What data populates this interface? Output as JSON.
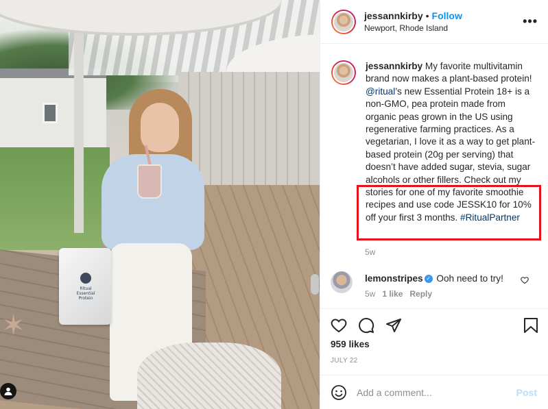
{
  "header": {
    "username": "jessannkirby",
    "dot": "•",
    "follow_label": "Follow",
    "location": "Newport, Rhode Island",
    "more_label": "•••"
  },
  "photo": {
    "bag_label": "Ritual Essential Protein"
  },
  "caption": {
    "username": "jessannkirby",
    "text_part1": " My favorite multivitamin brand now makes a plant-based protein! ",
    "mention": "@ritual",
    "text_part2": "’s new Essential Protein 18+ is a non-GMO, pea protein made from organic peas grown in the US using regenerative farming practices. As a vegetarian, I love it as a way to get plant-based protein (20g per serving) that doesn’t have added sugar, stevia, sugar alcohols or other fillers. Check out my stories for one of my favorite smoothie recipes and use code JESSK10 for 10% off your first 3 months. ",
    "hashtag": "#RitualPartner",
    "time_ago": "5w"
  },
  "comment": {
    "username": "lemonstripes",
    "verified_mark": "✓",
    "text": "Ooh need to try!",
    "time_ago": "5w",
    "likes": "1 like",
    "reply_label": "Reply"
  },
  "actions": {
    "likes": "959 likes",
    "date": "JULY 22"
  },
  "add_comment": {
    "placeholder": "Add a comment...",
    "post_label": "Post"
  },
  "colors": {
    "accent": "#0095f6",
    "highlight": "#e8101a",
    "link": "#00376b",
    "post_disabled": "#b2dffc"
  }
}
